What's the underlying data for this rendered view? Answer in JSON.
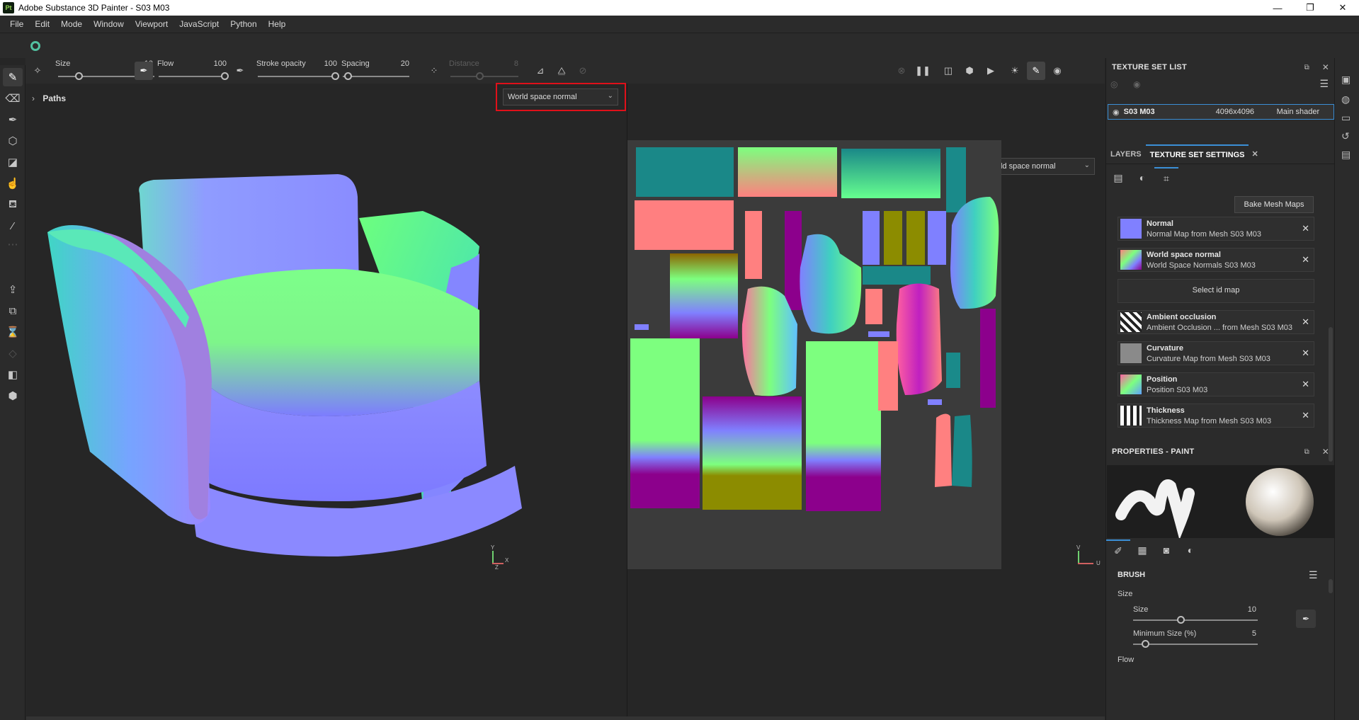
{
  "window": {
    "app_logo": "Pt",
    "title": "Adobe Substance 3D Painter - S03 M03",
    "controls": [
      "—",
      "❐",
      "✕"
    ]
  },
  "menu": [
    "File",
    "Edit",
    "Mode",
    "Window",
    "Viewport",
    "JavaScript",
    "Python",
    "Help"
  ],
  "toolbar": {
    "size_label": "Size",
    "size_value": "10",
    "flow_label": "Flow",
    "flow_value": "100",
    "stroke_opacity_label": "Stroke opacity",
    "stroke_opacity_value": "100",
    "spacing_label": "Spacing",
    "spacing_value": "20",
    "distance_label": "Distance",
    "distance_value": "8"
  },
  "viewport": {
    "paths_label": "Paths",
    "left_channel": "World space normal",
    "right_channel": "World space normal",
    "axis_3d_y": "Y",
    "axis_3d_x": "X",
    "axis_3d_z": "Z",
    "axis_2d_v": "V",
    "axis_2d_u": "U"
  },
  "texture_set_list": {
    "title": "TEXTURE SET LIST",
    "row_name": "S03 M03",
    "row_resolution": "4096x4096",
    "row_shader": "Main shader"
  },
  "tabs": {
    "layers": "LAYERS",
    "texture_set_settings": "TEXTURE SET SETTINGS",
    "close": "✕"
  },
  "bake_label": "Bake Mesh Maps",
  "mesh_maps": [
    {
      "name": "Normal",
      "sub": "Normal Map from Mesh S03 M03"
    },
    {
      "name": "World space normal",
      "sub": "World Space Normals S03 M03"
    },
    {
      "name": "Ambient occlusion",
      "sub": "Ambient Occlusion ... from Mesh S03 M03"
    },
    {
      "name": "Curvature",
      "sub": "Curvature Map from Mesh S03 M03"
    },
    {
      "name": "Position",
      "sub": "Position S03 M03"
    },
    {
      "name": "Thickness",
      "sub": "Thickness Map from Mesh S03 M03"
    }
  ],
  "select_id_map": "Select id map",
  "properties": {
    "title": "PROPERTIES - PAINT",
    "brush_title": "BRUSH",
    "size_group": "Size",
    "size_label": "Size",
    "size_value": "10",
    "min_size_label": "Minimum Size (%)",
    "min_size_value": "5",
    "flow_label": "Flow"
  },
  "colors": {
    "accent": "#3b8fd6",
    "highlight": "#e0101a",
    "panel": "#2b2b2b",
    "viewport": "#262626"
  }
}
